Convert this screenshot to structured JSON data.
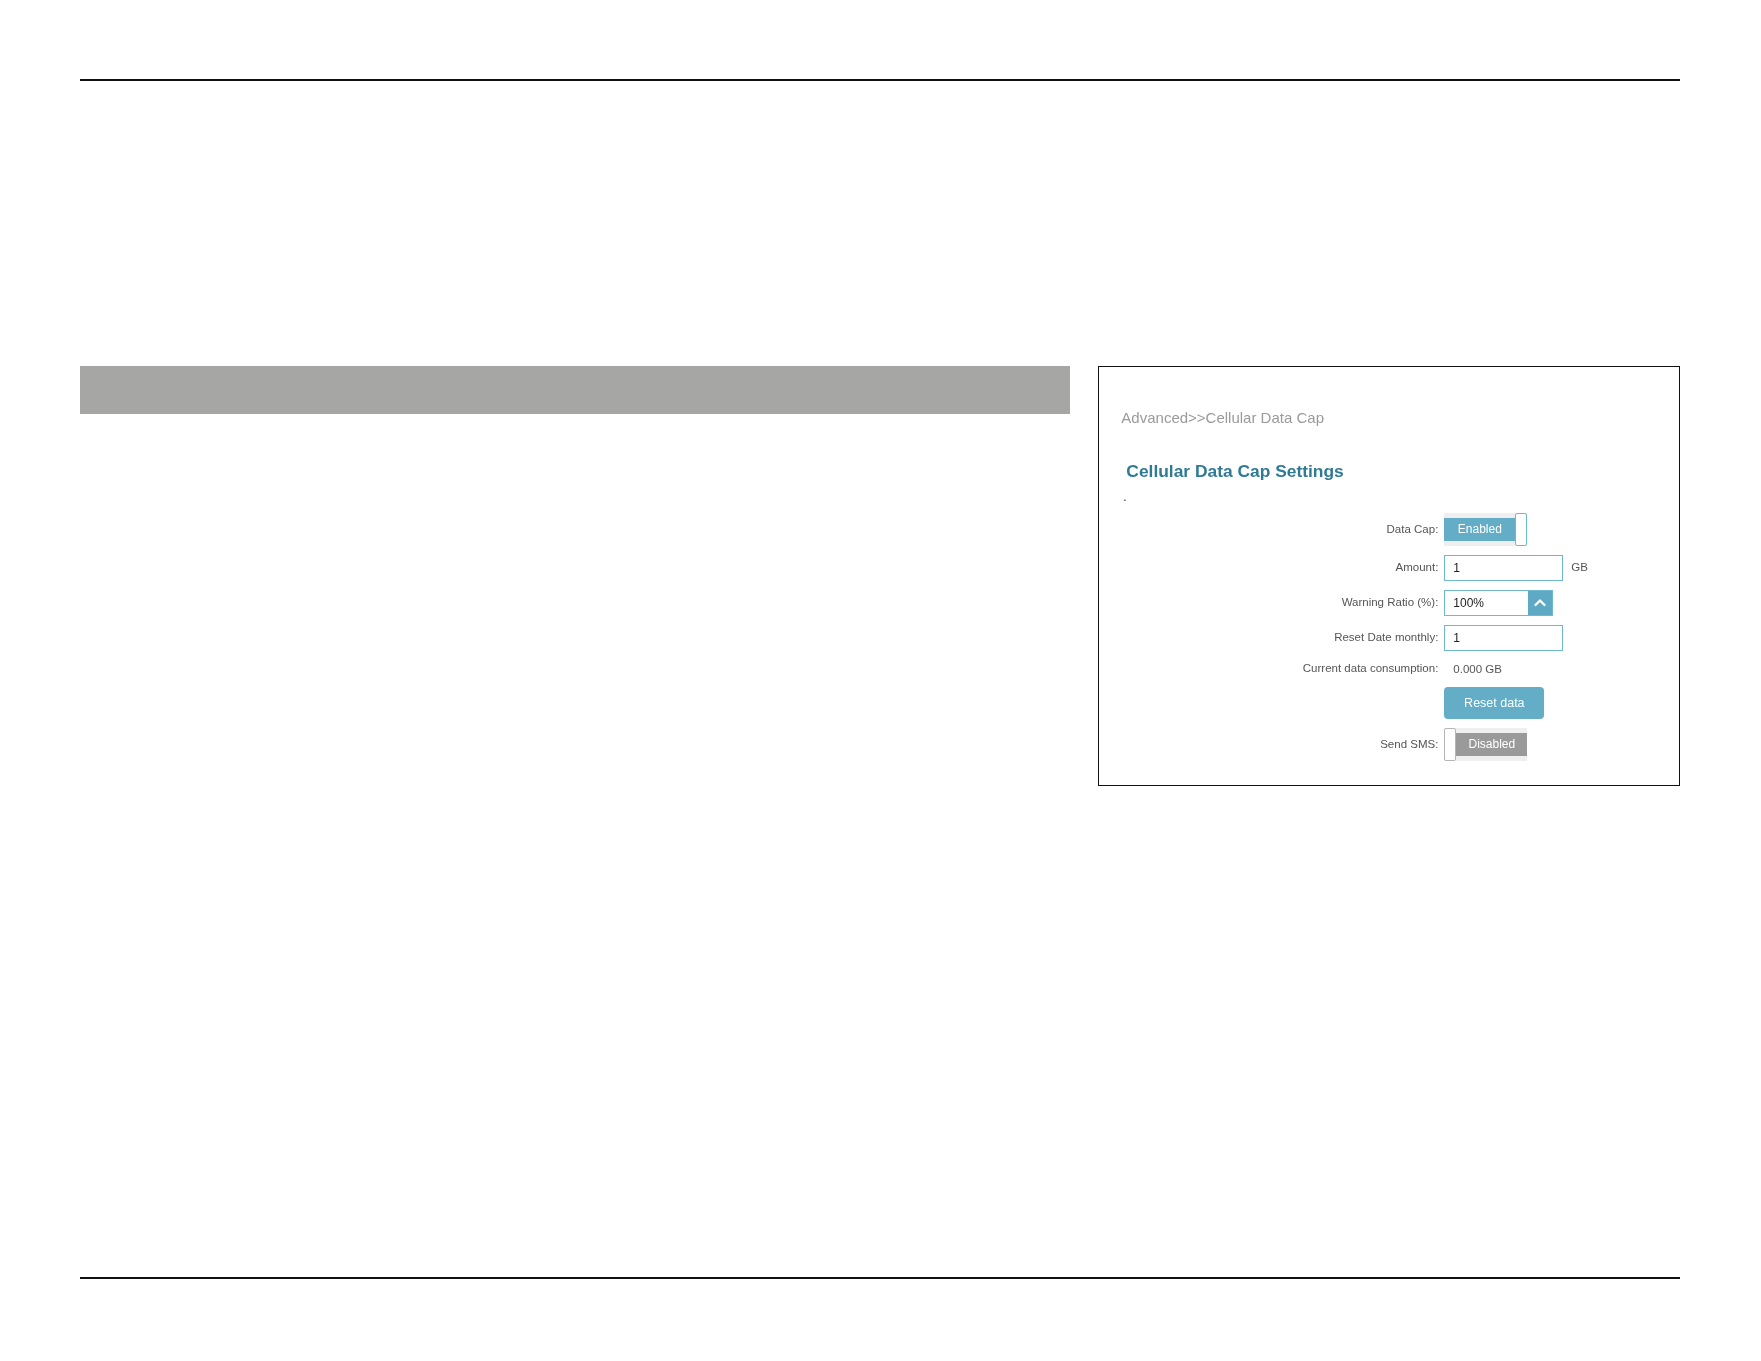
{
  "breadcrumb": "Advanced>>Cellular Data Cap",
  "title": "Cellular Data Cap Settings",
  "note": ".",
  "fields": [
    {
      "kind": "toggle",
      "label": "Data Cap:",
      "value": "Enabled",
      "on": true
    },
    {
      "kind": "input",
      "label": "Amount:",
      "value": "1",
      "unit": "GB"
    },
    {
      "kind": "select",
      "label": "Warning Ratio (%):",
      "value": "100%"
    },
    {
      "kind": "input",
      "label": "Reset Date monthly:",
      "value": "1"
    },
    {
      "kind": "text",
      "label": "Current data consumption:",
      "value": "0.000 GB"
    },
    {
      "kind": "button",
      "text": "Reset data"
    },
    {
      "kind": "toggle",
      "label": "Send SMS:",
      "value": "Disabled",
      "on": false
    }
  ]
}
